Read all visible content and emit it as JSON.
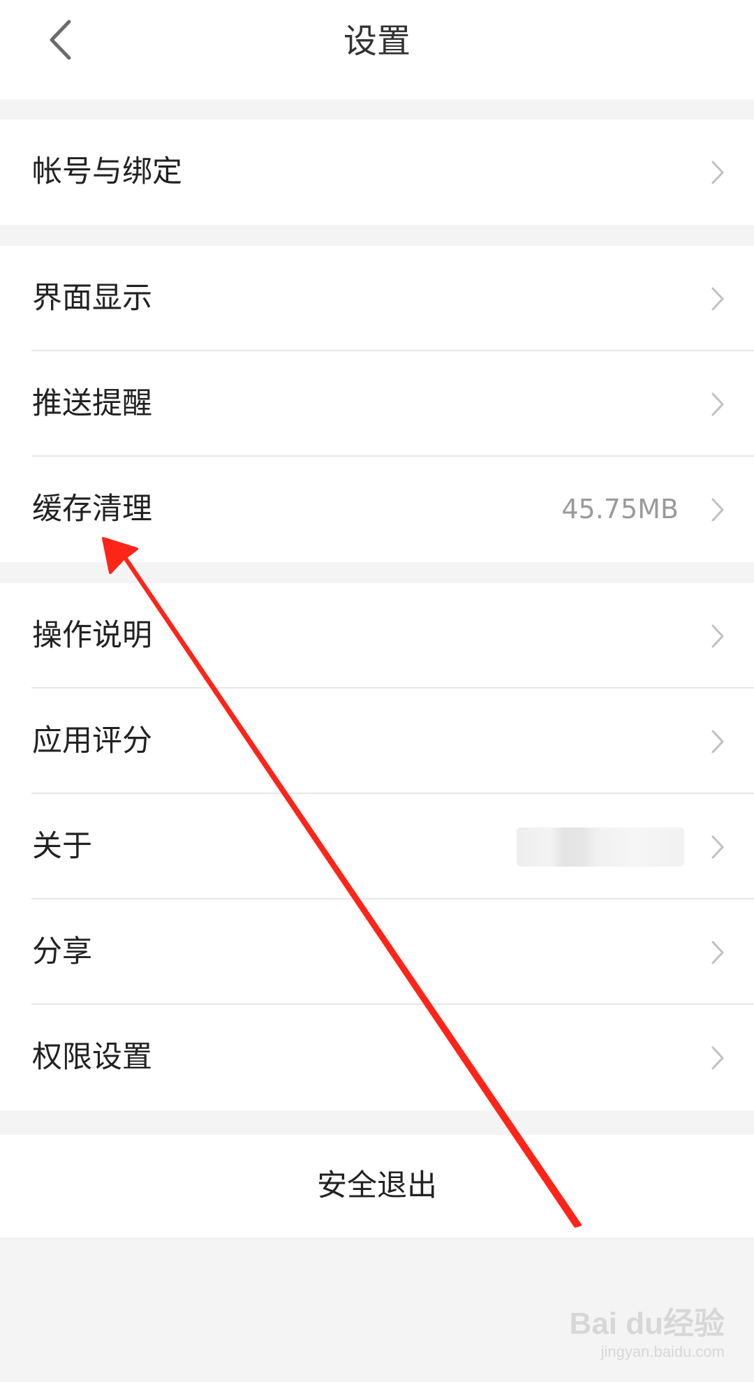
{
  "header": {
    "back_icon": "chevron-left-icon",
    "title": "设置"
  },
  "groups": [
    {
      "items": [
        {
          "label": "帐号与绑定"
        }
      ]
    },
    {
      "items": [
        {
          "label": "界面显示"
        },
        {
          "label": "推送提醒"
        },
        {
          "label": "缓存清理",
          "value": "45.75MB"
        }
      ]
    },
    {
      "items": [
        {
          "label": "操作说明"
        },
        {
          "label": "应用评分"
        },
        {
          "label": "关于"
        },
        {
          "label": "分享"
        },
        {
          "label": "权限设置"
        }
      ]
    }
  ],
  "logout": {
    "label": "安全退出"
  },
  "annotation": {
    "color": "#ff2418"
  },
  "watermark": {
    "line1": "Bai du经验",
    "line2": "jingyan.baidu.com"
  },
  "colors": {
    "background": "#f4f4f4",
    "surface": "#ffffff",
    "chevron": "#c0c0c0"
  }
}
